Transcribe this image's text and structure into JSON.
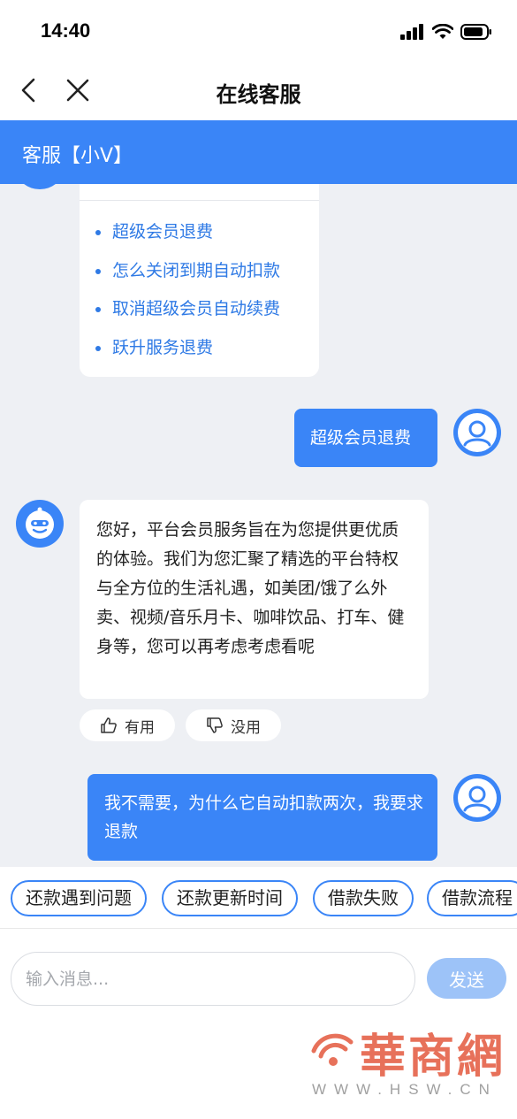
{
  "status_bar": {
    "time": "14:40"
  },
  "nav": {
    "title": "在线客服"
  },
  "header": {
    "title": "客服【小V】"
  },
  "faq": {
    "items": [
      {
        "label": "超级会员退费"
      },
      {
        "label": "怎么关闭到期自动扣款"
      },
      {
        "label": "取消超级会员自动续费"
      },
      {
        "label": "跃升服务退费"
      }
    ]
  },
  "messages": {
    "user_1": "超级会员退费",
    "bot_1": "您好，平台会员服务旨在为您提供更优质的体验。我们为您汇聚了精选的平台特权与全方位的生活礼遇，如美团/饿了么外卖、视频/音乐月卡、咖啡饮品、打车、健身等，您可以再考虑考虑看呢",
    "user_2": "我不需要，为什么它自动扣款两次，我要求退款"
  },
  "feedback": {
    "useful": "有用",
    "useless": "没用"
  },
  "quick_replies": [
    {
      "label": "还款遇到问题"
    },
    {
      "label": "还款更新时间"
    },
    {
      "label": "借款失败"
    },
    {
      "label": "借款流程"
    }
  ],
  "input": {
    "placeholder": "输入消息...",
    "value": ""
  },
  "send_button": "发送",
  "watermark": {
    "brand": "華商網",
    "domain": "WWW.HSW.CN"
  },
  "colors": {
    "accent": "#3a85f7",
    "link": "#2f7ae5",
    "chat_bg": "#eef0f4",
    "send_disabled": "#9dc3f8"
  },
  "icons": {
    "back": "chevron-left-icon",
    "close": "close-icon",
    "useful": "thumbs-up-icon",
    "useless": "thumbs-down-icon"
  }
}
